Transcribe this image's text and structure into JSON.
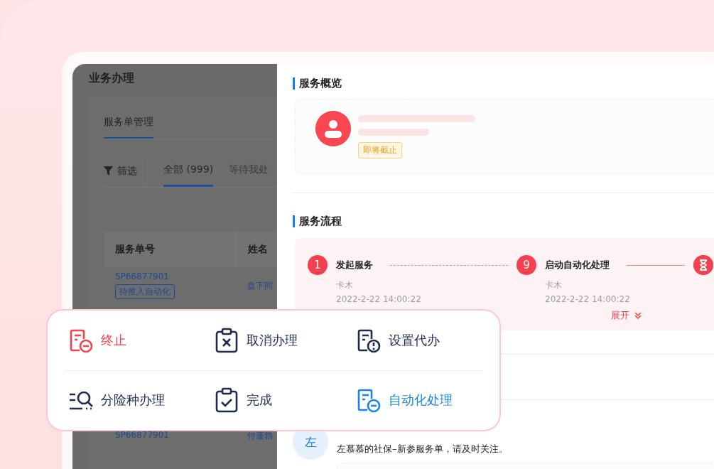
{
  "left_panel": {
    "title": "业务办理",
    "tab": {
      "label": "服务单管理",
      "selected": true
    },
    "filter": {
      "label": "筛选"
    },
    "status_tabs": [
      {
        "label": "全部 (999)",
        "selected": true
      },
      {
        "label": "等待我处",
        "selected": false
      }
    ],
    "table": {
      "columns": [
        "服务单号",
        "姓名"
      ],
      "rows": [
        {
          "number": "SP66877901",
          "tag": "待推入自动化",
          "name": "盘下同"
        },
        {
          "number": "SP66877901",
          "name": "付蓬勃"
        }
      ]
    }
  },
  "drawer": {
    "overview": {
      "title": "服务概览",
      "badge": "即将截止"
    },
    "flow": {
      "title": "服务流程",
      "expand": "展开",
      "steps": [
        {
          "kind": "number",
          "marker": "1",
          "label": "发起服务",
          "person": "卡木",
          "time": "2022-2-22 14:00:22",
          "dashed": true
        },
        {
          "kind": "number",
          "marker": "9",
          "label": "启动自动化处理",
          "person": "卡木",
          "time": "2022-2-22 14:00:22",
          "dashed": false
        },
        {
          "kind": "hourglass"
        }
      ]
    },
    "message": {
      "avatar": "左",
      "text": "左慕慕的社保–新参服务单，请及时关注。"
    }
  },
  "actions": [
    {
      "kind": "doc-minus",
      "label": "终止",
      "color": "#f5404f"
    },
    {
      "kind": "clipboard-x",
      "label": "取消办理",
      "color": "#1d2b4f"
    },
    {
      "kind": "doc-alert",
      "label": "设置代办",
      "color": "#1d2b4f"
    },
    {
      "kind": "lines-search",
      "label": "分险种办理",
      "color": "#1d2b4f"
    },
    {
      "kind": "clipboard-check",
      "label": "完成",
      "color": "#1d2b4f"
    },
    {
      "kind": "doc-minus",
      "label": "自动化处理",
      "color": "#1a84e8"
    }
  ]
}
